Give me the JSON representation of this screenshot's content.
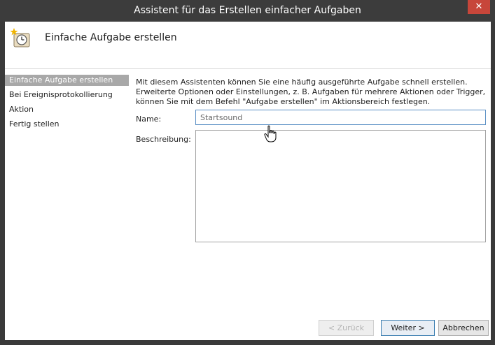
{
  "window": {
    "title": "Assistent für das Erstellen einfacher Aufgaben",
    "close_label": "✕"
  },
  "header": {
    "title": "Einfache Aufgabe erstellen",
    "icon": "task-scheduler-clock-icon"
  },
  "nav": {
    "items": [
      {
        "label": "Einfache Aufgabe erstellen",
        "selected": true
      },
      {
        "label": "Bei Ereignisprotokollierung",
        "selected": false
      },
      {
        "label": "Aktion",
        "selected": false
      },
      {
        "label": "Fertig stellen",
        "selected": false
      }
    ]
  },
  "content": {
    "intro_line1": "Mit diesem Assistenten können Sie eine häufig ausgeführte Aufgabe schnell erstellen.",
    "intro_line2": "Erweiterte Optionen oder Einstellungen, z. B. Aufgaben für mehrere Aktionen oder Trigger,",
    "intro_line3": "können Sie mit dem Befehl \"Aufgabe erstellen\" im Aktionsbereich festlegen.",
    "name_label": "Name:",
    "name_value": "Startsound",
    "description_label": "Beschreibung:",
    "description_value": ""
  },
  "buttons": {
    "back": "< Zurück",
    "next": "Weiter >",
    "cancel": "Abbrechen"
  },
  "colors": {
    "titlebar": "#3c3c3c",
    "close": "#c7463a",
    "nav_selected": "#a8a8a8",
    "input_focus_border": "#5a8fc4"
  }
}
